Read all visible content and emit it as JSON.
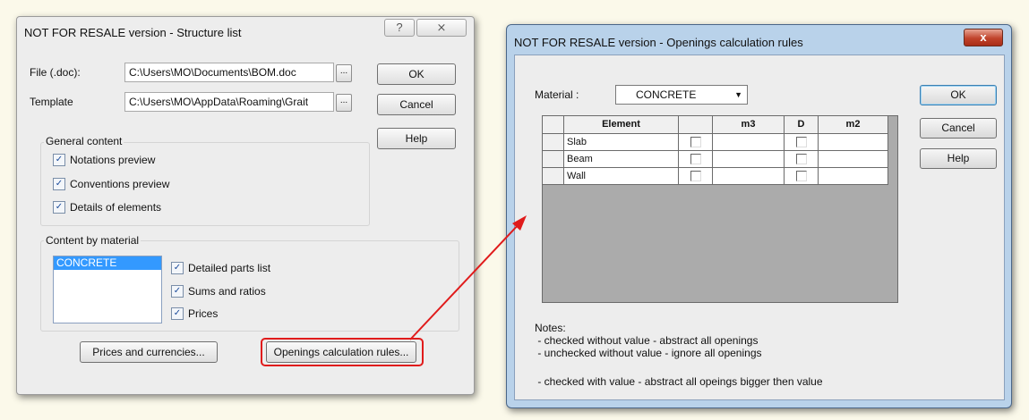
{
  "structure_list": {
    "title": "NOT FOR RESALE version - Structure list",
    "help_glyph": "?",
    "close_glyph": "⨯",
    "file_label": "File (.doc):",
    "file_value": "C:\\Users\\MO\\Documents\\BOM.doc",
    "template_label": "Template",
    "template_value": "C:\\Users\\MO\\AppData\\Roaming\\Grait",
    "browse_label": "...",
    "ok_label": "OK",
    "cancel_label": "Cancel",
    "help_label": "Help",
    "general_content": {
      "label": "General content",
      "items": [
        {
          "label": "Notations preview",
          "checked": true
        },
        {
          "label": "Conventions preview",
          "checked": true
        },
        {
          "label": "Details of elements",
          "checked": true
        }
      ]
    },
    "content_by_material": {
      "label": "Content by material",
      "materials": [
        "CONCRETE"
      ],
      "items": [
        {
          "label": "Detailed parts list",
          "checked": true
        },
        {
          "label": "Sums and ratios",
          "checked": true
        },
        {
          "label": "Prices",
          "checked": true
        }
      ]
    },
    "prices_button": "Prices and currencies...",
    "openings_button": "Openings calculation rules..."
  },
  "openings_rules": {
    "title": "NOT FOR RESALE version - Openings calculation rules",
    "close_glyph": "x",
    "material_label": "Material :",
    "material_value": "CONCRETE",
    "ok_label": "OK",
    "cancel_label": "Cancel",
    "help_label": "Help",
    "table": {
      "headers": [
        "Element",
        "",
        "m3",
        "D",
        "m2"
      ],
      "rows": [
        {
          "element": "Slab",
          "checked": false,
          "m3": "",
          "d": false,
          "m2": ""
        },
        {
          "element": "Beam",
          "checked": false,
          "m3": "",
          "d": false,
          "m2": ""
        },
        {
          "element": "Wall",
          "checked": false,
          "m3": "",
          "d": false,
          "m2": ""
        }
      ]
    },
    "notes": {
      "heading": "Notes:",
      "lines": [
        " - checked without value - abstract all openings",
        " - unchecked without value - ignore all openings",
        " - checked with value - abstract all opeings bigger then value"
      ]
    }
  },
  "colors": {
    "highlight_outline": "#e01b1b",
    "arrow": "#e01b1b",
    "selection": "#3399ff"
  }
}
